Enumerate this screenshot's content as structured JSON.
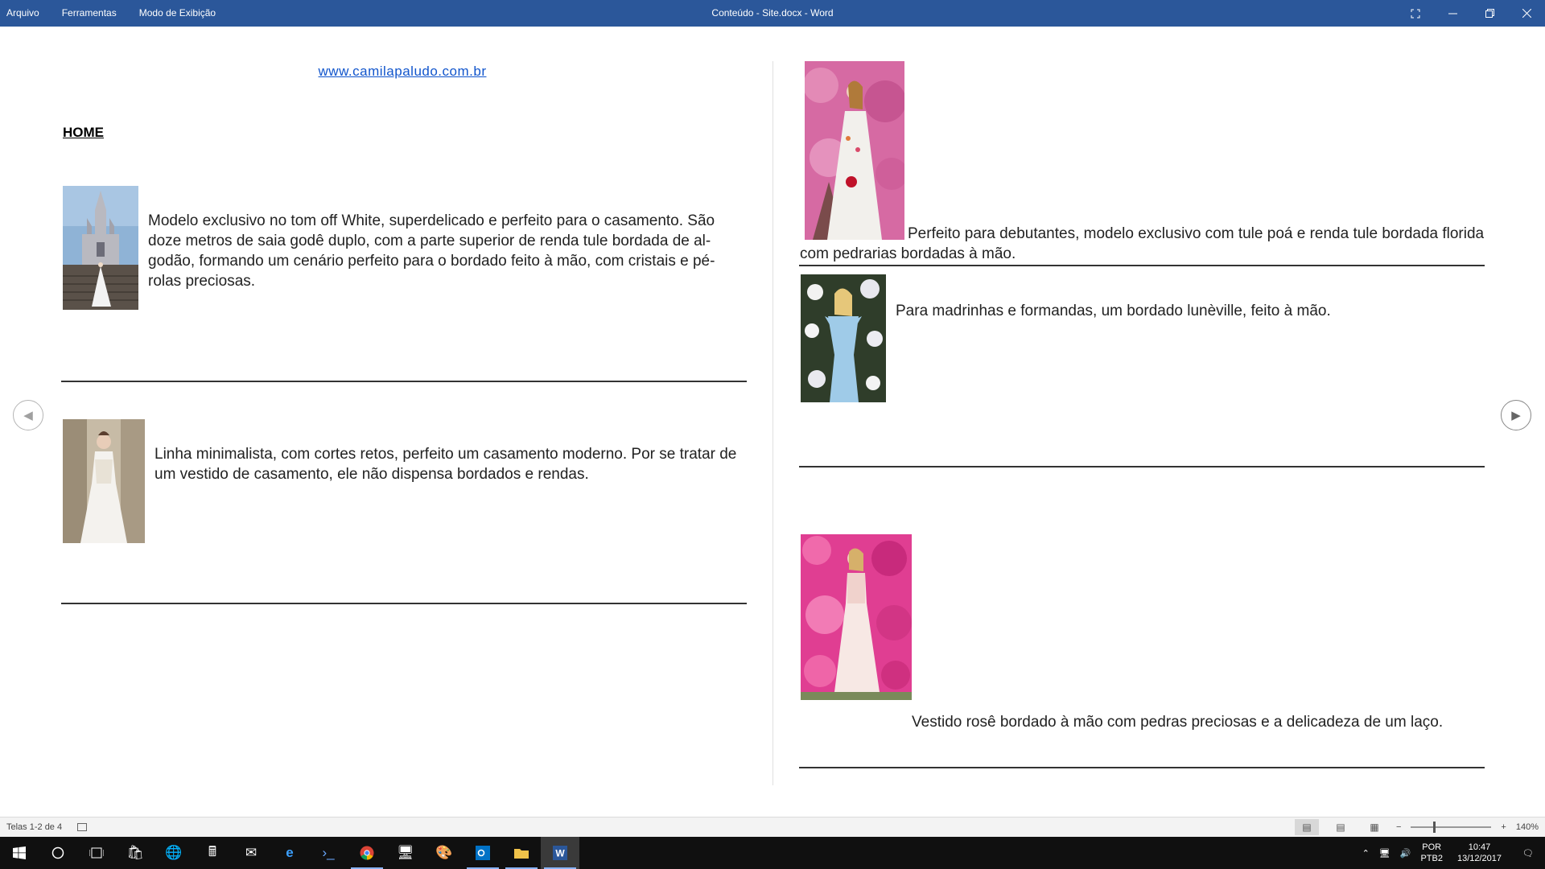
{
  "window": {
    "menu": [
      "Arquivo",
      "Ferramentas",
      "Modo de Exibição"
    ],
    "title": "Conteúdo - Site.docx  -  Word"
  },
  "document": {
    "link": "www.camilapaludo.com.br",
    "heading": "HOME",
    "sections": [
      {
        "text": "Modelo exclusivo no tom off White, superdelicado e perfeito para o casamento. São doze metros de saia godê duplo, com a parte superior de renda tule bordada de al-godão, formando um cenário perfeito para o bordado feito à mão, com cristais e pé-rolas preciosas."
      },
      {
        "text": "Linha minimalista, com cortes retos, perfeito um casamento moderno. Por se tratar de um vestido de casamento, ele não dispensa bordados e rendas."
      },
      {
        "text": "Perfeito para debutantes, modelo exclusivo com tule poá e renda tule bordada florida com pedrarias bordadas à mão."
      },
      {
        "text": "Para madrinhas e formandas, um bordado lunèville, feito à mão."
      },
      {
        "text": "Vestido rosê bordado à mão com pedras preciosas e a delicadeza de um laço."
      }
    ]
  },
  "status": {
    "pages": "Telas 1-2 de 4",
    "zoom": "140%"
  },
  "taskbar": {
    "language": "POR",
    "keyboard": "PTB2",
    "time": "10:47",
    "date": "13/12/2017"
  }
}
